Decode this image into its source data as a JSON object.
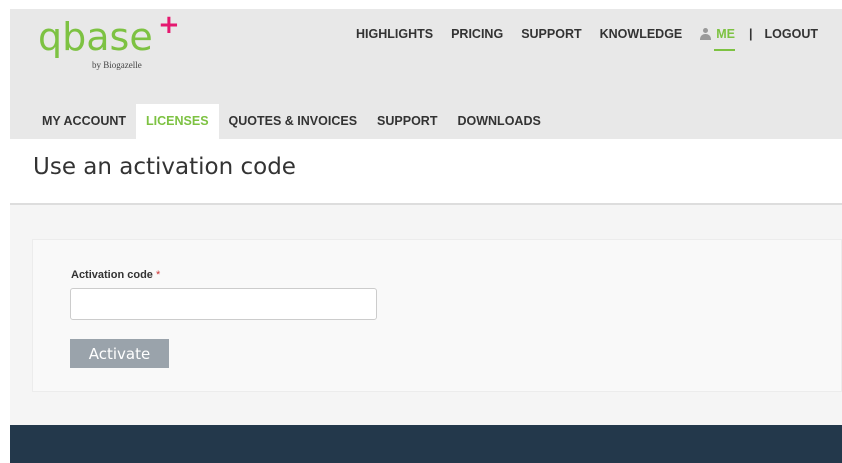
{
  "logo": {
    "wordmark": "qbase",
    "plus": "+",
    "byline": "by Biogazelle",
    "colors": {
      "wordmark": "#7dc242",
      "plus": "#e5186f"
    }
  },
  "top_nav": {
    "items": [
      {
        "label": "HIGHLIGHTS"
      },
      {
        "label": "PRICING"
      },
      {
        "label": "SUPPORT"
      },
      {
        "label": "KNOWLEDGE"
      }
    ],
    "me_icon": "user-icon",
    "me_label": "ME",
    "separator": "|",
    "logout_label": "LOGOUT"
  },
  "sub_nav": {
    "tabs": [
      {
        "label": "MY ACCOUNT",
        "active": false
      },
      {
        "label": "LICENSES",
        "active": true
      },
      {
        "label": "QUOTES & INVOICES",
        "active": false
      },
      {
        "label": "SUPPORT",
        "active": false
      },
      {
        "label": "DOWNLOADS",
        "active": false
      }
    ]
  },
  "page": {
    "title": "Use an activation code"
  },
  "form": {
    "activation_code_label": "Activation code",
    "required_marker": "*",
    "activation_code_value": "",
    "activate_button_label": "Activate"
  },
  "colors": {
    "accent": "#7dc242",
    "header_bg": "#e8e8e8",
    "footer_bg": "#23384b",
    "button_bg": "#9aa3ab"
  }
}
